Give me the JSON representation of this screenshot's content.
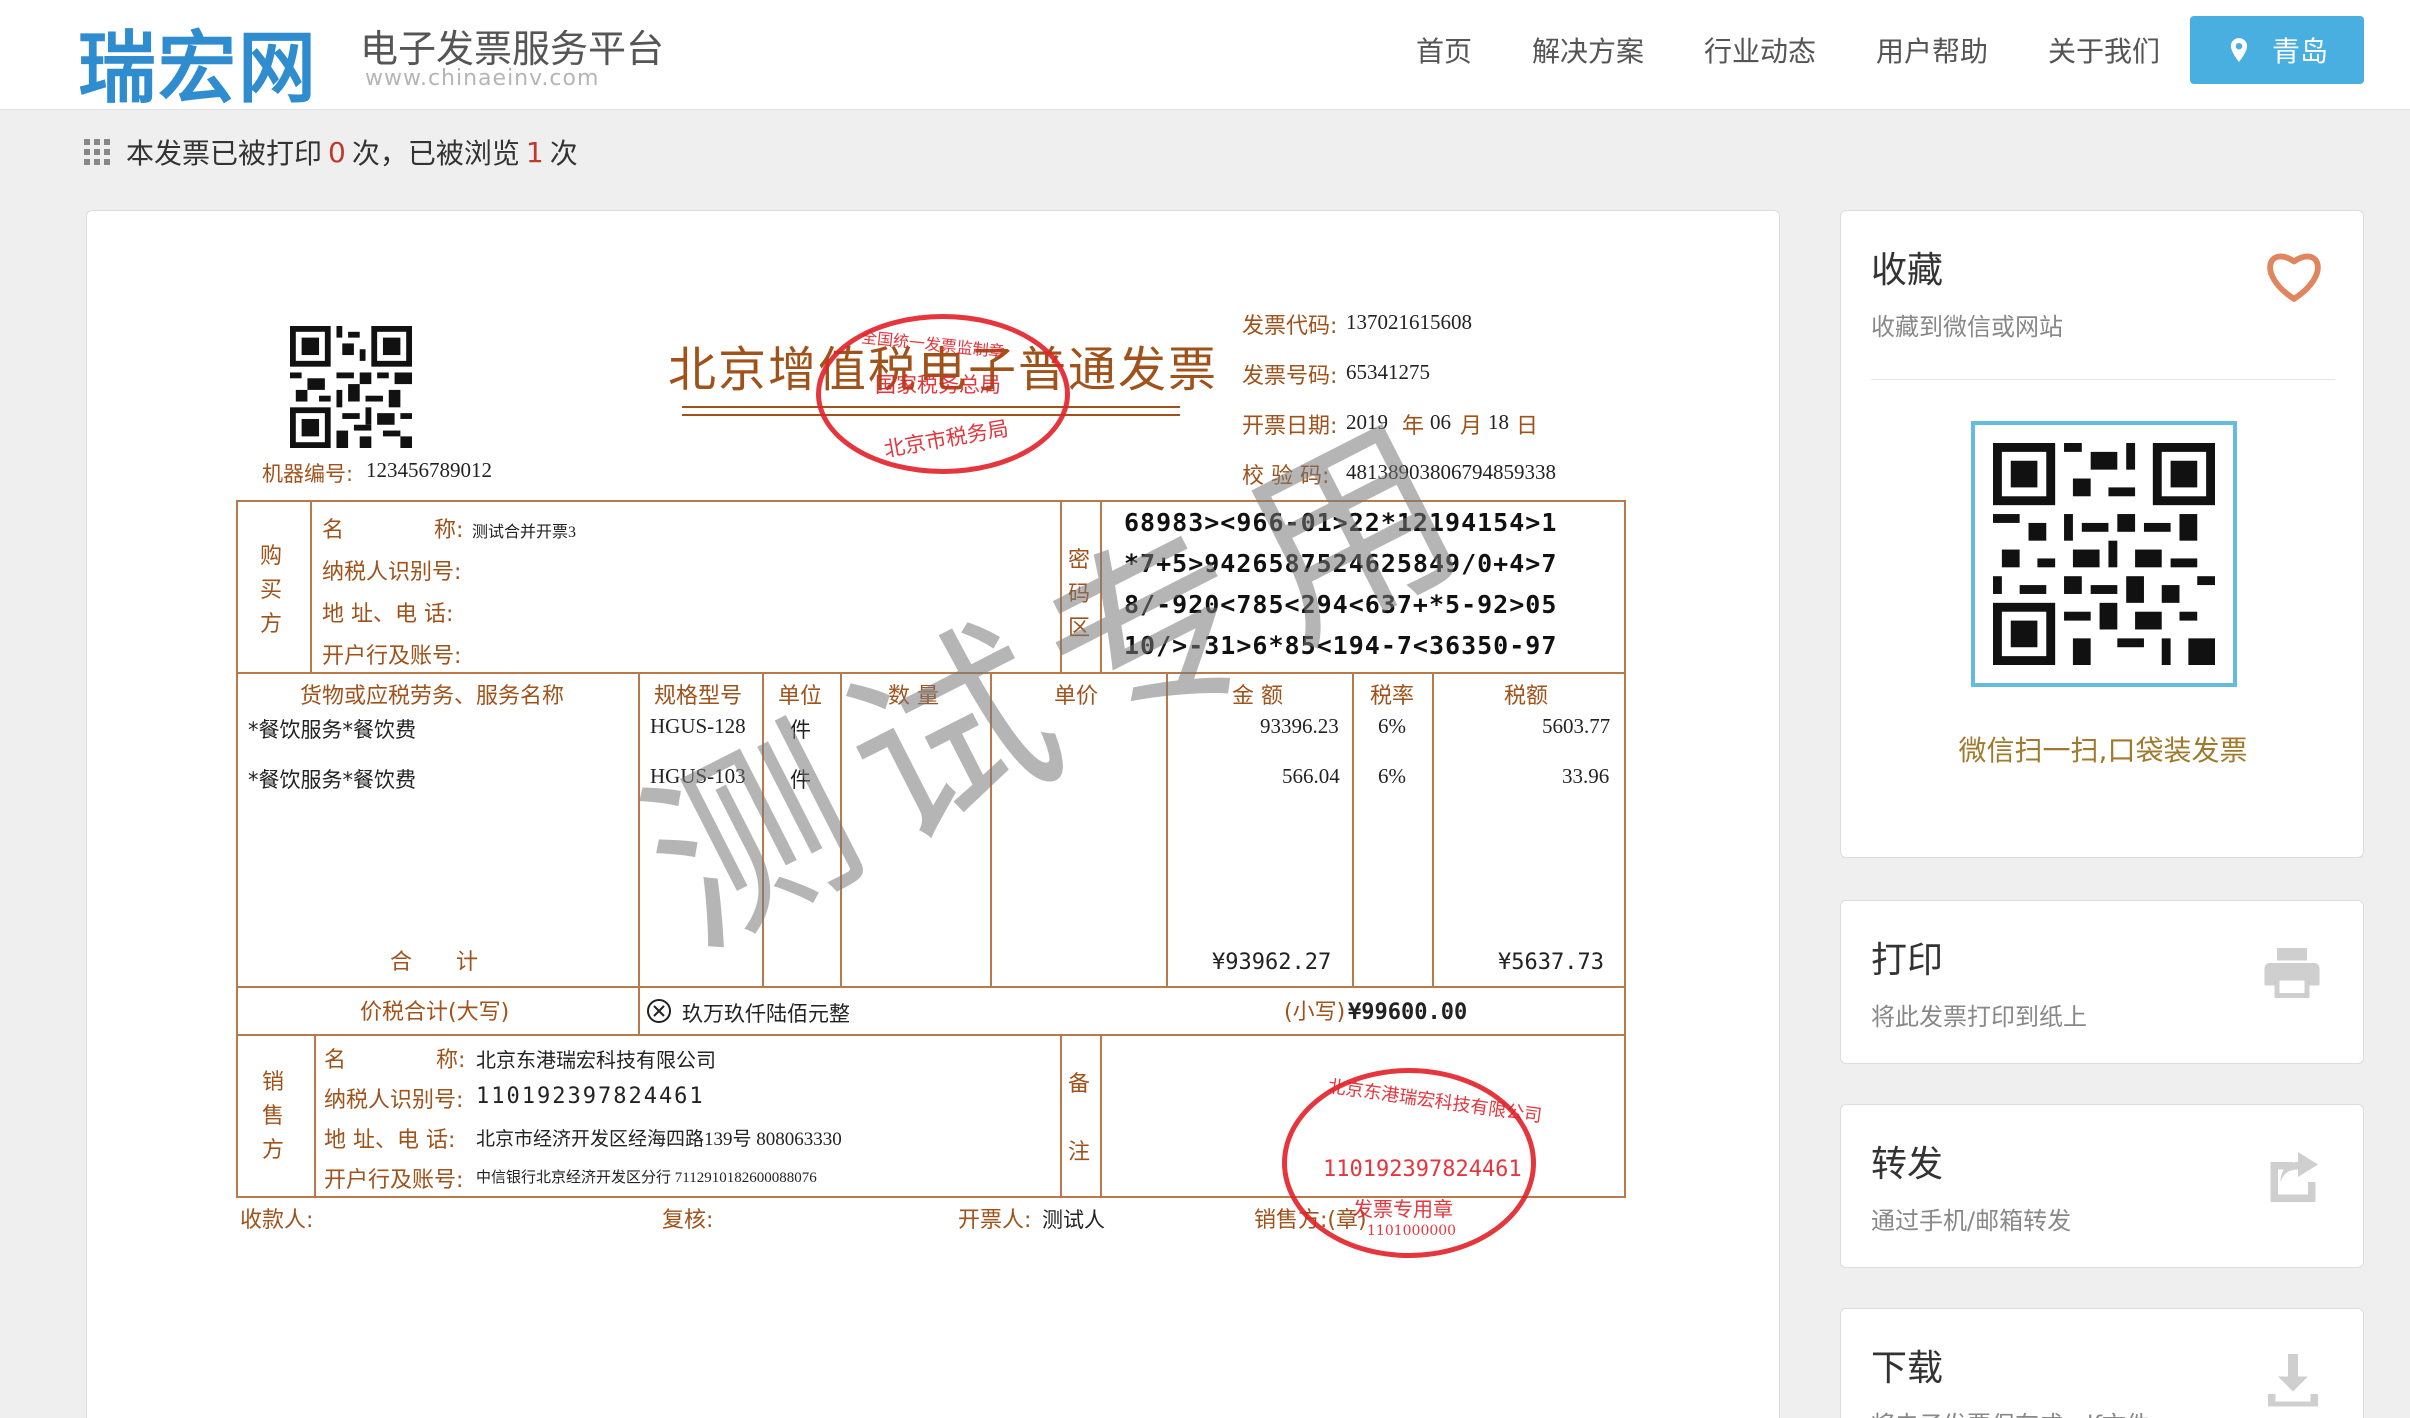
{
  "header": {
    "logo": "瑞宏网",
    "title": "电子发票服务平台",
    "url": "www.chinaeinv.com",
    "nav": [
      "首页",
      "解决方案",
      "行业动态",
      "用户帮助",
      "关于我们"
    ],
    "city": "青岛"
  },
  "counter": {
    "prefix": "本发票已被打印",
    "printed": "0",
    "middle": "次，已被浏览",
    "viewed": "1",
    "suffix": "次"
  },
  "invoice": {
    "title": "北京增值税电子普通发票",
    "machine_label": "机器编号:",
    "machine_no": "123456789012",
    "code_label": "发票代码:",
    "code": "137021615608",
    "number_label": "发票号码:",
    "number": "65341275",
    "date_label": "开票日期:",
    "date_year": "2019",
    "date_nian": "年",
    "date_month": "06",
    "date_yue": "月",
    "date_day": "18",
    "date_ri": "日",
    "check_label": "校 验 码:",
    "check": "48138903806794859338",
    "buyer_side": [
      "购",
      "买",
      "方"
    ],
    "buyer": {
      "name_label_a": "名",
      "name_label_b": "称:",
      "name": "测试合并开票3",
      "taxid_label": "纳税人识别号:",
      "addr_label": "地 址、电 话:",
      "bank_label": "开户行及账号:"
    },
    "cipher_side": [
      "密",
      "码",
      "区"
    ],
    "cipher": [
      "68983><966-01>22*12194154>1",
      "*7+5>9426587524625849/0+4>7",
      "8/-920<785<294<637+*5-92>05",
      "10/>-31>6*85<194-7<36350-97"
    ],
    "headers": {
      "item": "货物或应税劳务、服务名称",
      "spec": "规格型号",
      "unit": "单位",
      "qty": "数 量",
      "price": "单价",
      "amount": "金 额",
      "rate": "税率",
      "tax": "税额"
    },
    "items": [
      {
        "name": "*餐饮服务*餐饮费",
        "spec": "HGUS-128",
        "unit": "件",
        "amount": "93396.23",
        "rate": "6%",
        "tax": "5603.77"
      },
      {
        "name": "*餐饮服务*餐饮费",
        "spec": "HGUS-103",
        "unit": "件",
        "amount": "566.04",
        "rate": "6%",
        "tax": "33.96"
      }
    ],
    "total_label": "合　　计",
    "total_amount": "¥93962.27",
    "total_tax": "¥5637.73",
    "grand_label": "价税合计(大写)",
    "grand_words": "玖万玖仟陆佰元整",
    "grand_small_label": "(小写)",
    "grand_small": "¥99600.00",
    "seller_side": [
      "销",
      "售",
      "方"
    ],
    "seller": {
      "name_label_a": "名",
      "name_label_b": "称:",
      "name": "北京东港瑞宏科技有限公司",
      "taxid_label": "纳税人识别号:",
      "taxid": "110192397824461",
      "addr_label": "地 址、电 话:",
      "addr": "北京市经济开发区经海四路139号 808063330",
      "bank_label": "开户行及账号:",
      "bank": "中信银行北京经济开发区分行 7112910182600088076"
    },
    "remark_side": [
      "备",
      "注"
    ],
    "payee_label": "收款人:",
    "reviewer_label": "复核:",
    "issuer_label": "开票人:",
    "issuer": "测试人",
    "seller_seal_label": "销售方:(章)",
    "watermark": "测试专用",
    "stamp_top": {
      "line1": "国家税务总局",
      "line2": "北京市税务局",
      "arc": "全国统一发票监制章"
    },
    "stamp_seller": {
      "arc": "北京东港瑞宏科技有限公司",
      "taxid": "110192397824461",
      "line": "发票专用章",
      "bottom": "1101000000"
    }
  },
  "sidebar": {
    "favorite": {
      "title": "收藏",
      "sub": "收藏到微信或网站",
      "qr_caption": "微信扫一扫,口袋装发票"
    },
    "print": {
      "title": "打印",
      "sub": "将此发票打印到纸上"
    },
    "forward": {
      "title": "转发",
      "sub": "通过手机/邮箱转发"
    },
    "download": {
      "title": "下载",
      "sub": "将电子发票保存成pdf文件"
    }
  },
  "colors": {
    "accent": "#49aee0",
    "invoice_brown": "#a0521b",
    "stamp_red": "#e22028",
    "heart": "#e0855e"
  }
}
